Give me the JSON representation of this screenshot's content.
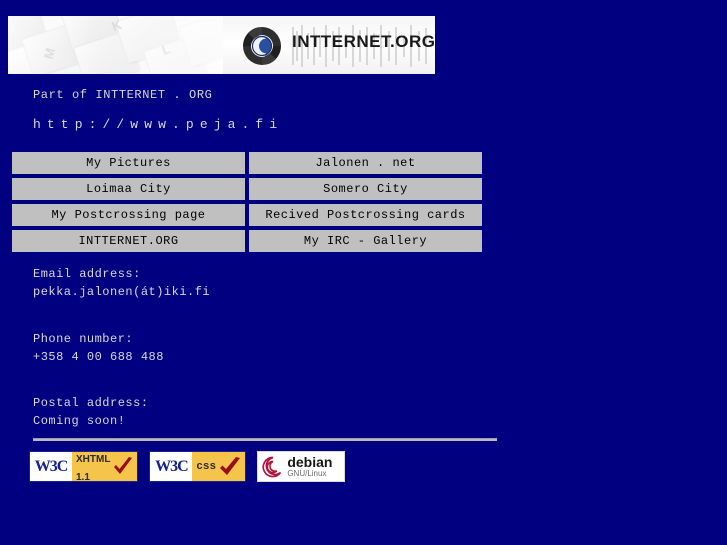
{
  "page": {
    "background_color": "#000080",
    "text_color": "#d8d8d8"
  },
  "banner": {
    "logo_icon": "intternet-swirl-moon-logo",
    "logo_text": "INTTERNET.ORG",
    "keyboard_image": "keyboard-keys-photo",
    "key_glyphs": [
      "M",
      "K",
      "L"
    ]
  },
  "intro": {
    "part_of": "Part of INTTERNET . ORG",
    "url": "http://www.peja.fi"
  },
  "links": {
    "rows": [
      {
        "left": "My Pictures",
        "right": "Jalonen . net"
      },
      {
        "left": "Loimaa City",
        "right": "Somero City"
      },
      {
        "left": "My Postcrossing page",
        "right": "Recived Postcrossing cards"
      },
      {
        "left": "INTTERNET.ORG",
        "right": "My IRC - Gallery"
      }
    ],
    "cell_background": "#c0c0c0"
  },
  "contact": {
    "email_label": "Email address:",
    "email_value": "pekka.jalonen(át)iki.fi",
    "phone_label": "Phone number:",
    "phone_value": "+358 4 00 688 488",
    "postal_label": "Postal address:",
    "postal_value": "Coming soon!"
  },
  "badges": [
    {
      "name": "w3c-xhtml-badge",
      "brand": "W3C",
      "label_line1": "XHTML",
      "label_line2": "1.1",
      "icon": "red-checkmark-icon"
    },
    {
      "name": "w3c-css-badge",
      "brand": "W3C",
      "label_line1": "css",
      "label_line2": "",
      "icon": "red-checkmark-icon"
    },
    {
      "name": "debian-badge",
      "brand": "debian",
      "label_line1": "GNU/Linux",
      "label_line2": "",
      "icon": "debian-swirl-icon"
    }
  ]
}
